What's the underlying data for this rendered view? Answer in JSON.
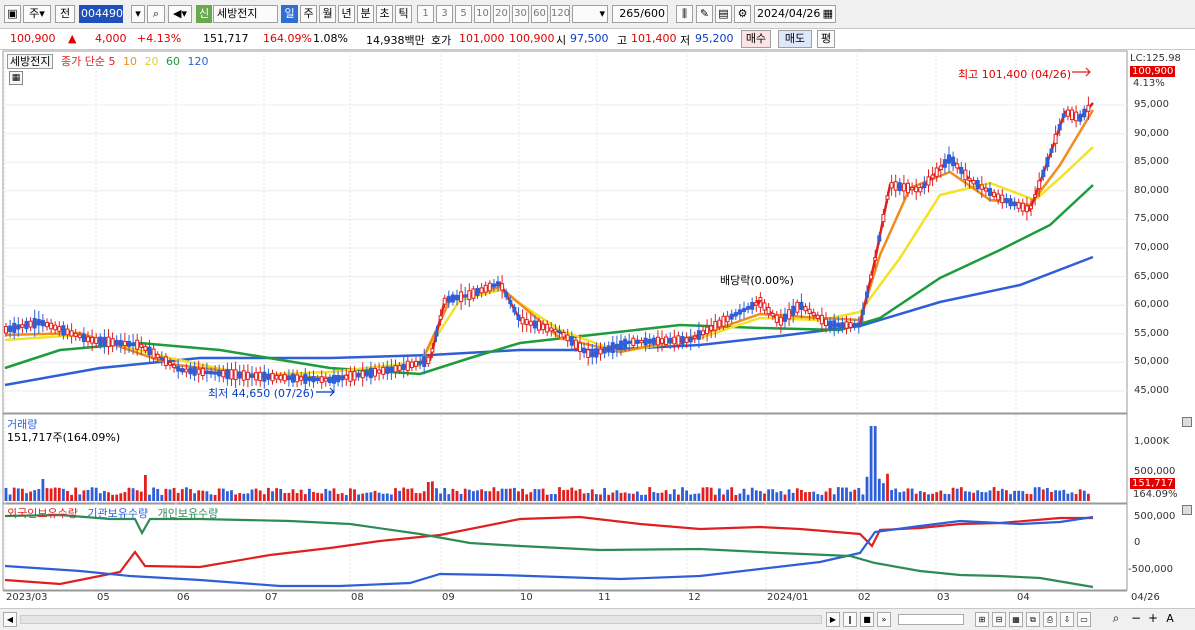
{
  "toolbar": {
    "market": "주",
    "prev_label": "전",
    "code": "004490",
    "stock_name": "세방전지",
    "new_badge": "신",
    "periods": [
      "일",
      "주",
      "월",
      "년",
      "분",
      "초",
      "틱"
    ],
    "active_period": "일",
    "intervals": [
      "1",
      "3",
      "5",
      "10",
      "20",
      "30",
      "60",
      "120"
    ],
    "count": "265",
    "count_total": "/600",
    "date": "2024/04/26"
  },
  "info": {
    "price": "100,900",
    "up_arrow": "▲",
    "change": "4,000",
    "change_pct": "+4.13%",
    "volume": "151,717",
    "volume_ratio": "164.09%",
    "turnover": "1.08%",
    "amount": "14,938백만",
    "quote_label": "호가",
    "ask": "101,000",
    "bid": "100,900",
    "open_label": "시",
    "open": "97,500",
    "high_label": "고",
    "high": "101,400",
    "low_label": "저",
    "low": "95,200",
    "buy": "매수",
    "sell": "매도",
    "eval": "평"
  },
  "price_panel": {
    "title": "세방전지",
    "ma_label": "종가 단순",
    "ma_periods": [
      "5",
      "10",
      "20",
      "60",
      "120"
    ],
    "ma_colors": [
      "#e02020",
      "#f28c1c",
      "#f4e226",
      "#1e9b3a",
      "#2f5fd7"
    ],
    "lc_label": "LC:125.98",
    "current_tag": "100,900",
    "current_pct": "4.13%",
    "high_annot": "최고 101,400 (04/26)",
    "low_annot": "최저 44,650 (07/26)",
    "dividend_annot": "배당락(0.00%)",
    "y_ticks": [
      "95,000",
      "90,000",
      "85,000",
      "80,000",
      "75,000",
      "70,000",
      "65,000",
      "60,000",
      "55,000",
      "50,000",
      "45,000"
    ]
  },
  "volume_panel": {
    "title": "거래량",
    "value_text": "151,717주(164.09%)",
    "y_ticks": [
      "1,000K",
      "500,000"
    ],
    "current_tag": "151,717",
    "current_pct": "164.09%"
  },
  "holder_panel": {
    "foreign": "외국인보유수량",
    "institution": "기관보유수량",
    "individual": "개인보유수량",
    "colors": {
      "foreign": "#e02020",
      "institution": "#2f5fd7",
      "individual": "#2e8b57"
    },
    "y_ticks": [
      "500,000",
      "0",
      "-500,000"
    ]
  },
  "x_axis": {
    "labels": [
      "2023/03",
      "05",
      "06",
      "07",
      "08",
      "09",
      "10",
      "11",
      "12",
      "2024/01",
      "02",
      "03",
      "04"
    ],
    "end_label": "04/26"
  }
}
